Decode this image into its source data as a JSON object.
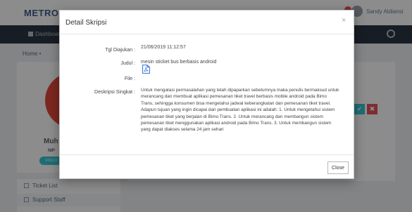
{
  "app": {
    "logo": "METRONIC",
    "user_name": "Sandy Aldiansi"
  },
  "nav": {
    "dashboard_label": "Dashboard"
  },
  "breadcrumb": "Home •",
  "profile": {
    "name": "Muh",
    "nip": "NIP",
    "follow_label": "FOLLO"
  },
  "side_menu": {
    "items": [
      {
        "label": "Ticket List",
        "icon": "home-icon"
      },
      {
        "label": "Support Staff",
        "icon": "settings-icon"
      }
    ]
  },
  "action_buttons": {
    "accept_glyph": "✔",
    "reject_glyph": "✖"
  },
  "modal": {
    "title": "Detail Skripsi",
    "close_glyph": "×",
    "fields": {
      "tgl_label": "Tgl Diajukan :",
      "tgl_value": "21/06/2019 11:12:57",
      "judul_label": "Judul :",
      "judul_value": "mesin sticket bus berbasis android",
      "file_label": "File :",
      "file_icon": "pdf-file-icon",
      "desc_label": "Deskripsi Singkat :",
      "desc_value": "Untuk mengatasi permasalahan yang telah dipaparkan sebelumnya maka penulis bermaksud untuk merancang dan membuat aplikasi pemesanan tiket travel berbasis mobile android pada Bimo Trans, sehingga konsumen bisa mengetahui jadwal keberangkatan dan pemesanan tiket travel. Adapun tujuan yang ingin dicapai dari pembuatan aplikasi ini adalah: 1. Untuk mengetahui sistem pemesanan tiket yang berjalan di Bimo Trans. 2. Untuk merancang dan membangun sistem pemesanan tiket menggunakan aplikasi android pada Bimo Trans. 3. Untuk membangun sistem yang dapat diakses selama 24 jam sehari"
    },
    "close_button_label": "Close"
  },
  "colors": {
    "navbar": "#2b3643",
    "accent_teal": "#36c6d3",
    "danger_red": "#e7505a",
    "pdf_blue": "#2e6fd6"
  }
}
